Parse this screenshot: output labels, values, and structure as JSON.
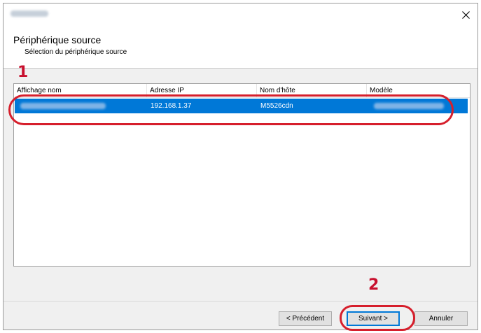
{
  "window": {
    "close_glyph": "×"
  },
  "header": {
    "title": "Périphérique source",
    "subtitle": "Sélection du périphérique source"
  },
  "steps": {
    "one": "1",
    "two": "2"
  },
  "table": {
    "columns": [
      "Affichage nom",
      "Adresse IP",
      "Nom d'hôte",
      "Modèle"
    ],
    "rows": [
      {
        "display_name": "",
        "ip": "192.168.1.37",
        "host": "M5526cdn",
        "model": ""
      }
    ]
  },
  "footer": {
    "back_label": "< Précédent",
    "next_label": "Suivant >",
    "cancel_label": "Annuler"
  },
  "colors": {
    "selection": "#0078d7",
    "annotation": "#d61f2c"
  }
}
